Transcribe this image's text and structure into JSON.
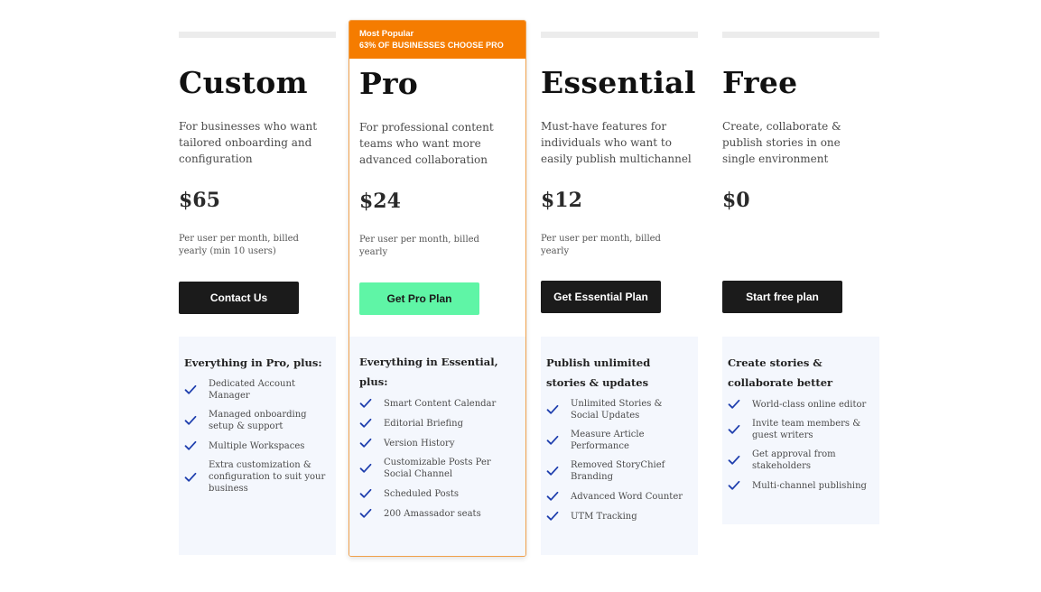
{
  "plans": {
    "custom": {
      "name": "Custom",
      "description": "For businesses who want tailored onboarding and configuration",
      "price": "$65",
      "billing": "Per user per month, billed yearly (min 10 users)",
      "button": "Contact Us",
      "features_heading": "Everything in Pro, plus:",
      "features": [
        "Dedicated Account Manager",
        "Managed onboarding setup & support",
        "Multiple Workspaces",
        "Extra customization & configuration to suit your business"
      ]
    },
    "pro": {
      "badge_title": "Most Popular",
      "badge_subtitle": "63% OF BUSINESSES CHOOSE PRO",
      "name": "Pro",
      "description": "For professional content teams who want more advanced collaboration",
      "price": "$24",
      "billing": "Per user per month, billed yearly",
      "button": "Get Pro Plan",
      "features_heading": "Everything in Essential, plus:",
      "features": [
        "Smart Content Calendar",
        "Editorial Briefing",
        "Version History",
        "Customizable Posts Per Social Channel",
        "Scheduled Posts",
        "200 Amassador seats"
      ]
    },
    "essential": {
      "name": "Essential",
      "description": "Must-have features for individuals who want to easily publish multichannel",
      "price": "$12",
      "billing": "Per user per month, billed yearly",
      "button": "Get Essential Plan",
      "features_heading": "Publish unlimited stories & updates",
      "features": [
        "Unlimited Stories & Social Updates",
        "Measure Article Performance",
        "Removed StoryChief Branding",
        "Advanced Word Counter",
        "UTM Tracking"
      ]
    },
    "free": {
      "name": "Free",
      "description": "Create, collaborate & publish stories in one single environment",
      "price": "$0",
      "button": "Start free plan",
      "features_heading": "Create stories & collaborate better",
      "features": [
        "World-class online editor",
        "Invite team members & guest writers",
        "Get approval from stakeholders",
        "Multi-channel publishing"
      ]
    }
  },
  "icons": {
    "check": "check-icon"
  },
  "colors": {
    "accent_orange": "#f57c00",
    "pro_button": "#5ff5a6",
    "dark_button": "#1b1b1b",
    "check": "#1f3fae",
    "feature_bg": "#f4f7fd"
  }
}
